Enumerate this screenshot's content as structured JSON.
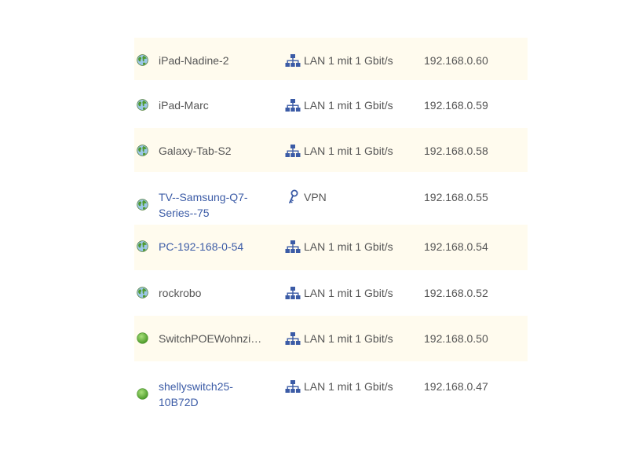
{
  "devices": [
    {
      "name": "iPad-Nadine-2",
      "link": false,
      "connection": "LAN 1 mit 1 Gbit/s",
      "conn_icon": "network-icon",
      "ip": "192.168.0.60",
      "status_icon": "globe-icon"
    },
    {
      "name": "iPad-Marc",
      "link": false,
      "connection": "LAN 1 mit 1 Gbit/s",
      "conn_icon": "network-icon",
      "ip": "192.168.0.59",
      "status_icon": "globe-icon"
    },
    {
      "name": "Galaxy-Tab-S2",
      "link": false,
      "connection": "LAN 1 mit 1 Gbit/s",
      "conn_icon": "network-icon",
      "ip": "192.168.0.58",
      "status_icon": "globe-icon"
    },
    {
      "name": "TV--Samsung-Q7-Series--75",
      "link": true,
      "connection": "VPN",
      "conn_icon": "key-icon",
      "ip": "192.168.0.55",
      "status_icon": "globe-icon"
    },
    {
      "name": "PC-192-168-0-54",
      "link": true,
      "connection": "LAN 1 mit 1 Gbit/s",
      "conn_icon": "network-icon",
      "ip": "192.168.0.54",
      "status_icon": "globe-icon"
    },
    {
      "name": "rockrobo",
      "link": false,
      "connection": "LAN 1 mit 1 Gbit/s",
      "conn_icon": "network-icon",
      "ip": "192.168.0.52",
      "status_icon": "globe-icon"
    },
    {
      "name": "SwitchPOEWohnzimmer",
      "link": false,
      "connection": "LAN 1 mit 1 Gbit/s",
      "conn_icon": "network-icon",
      "ip": "192.168.0.50",
      "status_icon": "green-dot-icon"
    },
    {
      "name": "shellyswitch25-10B72D",
      "link": true,
      "connection": "LAN 1 mit 1 Gbit/s",
      "conn_icon": "network-icon",
      "ip": "192.168.0.47",
      "status_icon": "green-dot-icon"
    }
  ],
  "colors": {
    "row_shaded": "#fffbee",
    "link": "#3b5ba6",
    "text": "#555555",
    "icon_blue": "#3b5ba6",
    "globe_green": "#4caf50",
    "dot_green": "#6cc04a"
  }
}
